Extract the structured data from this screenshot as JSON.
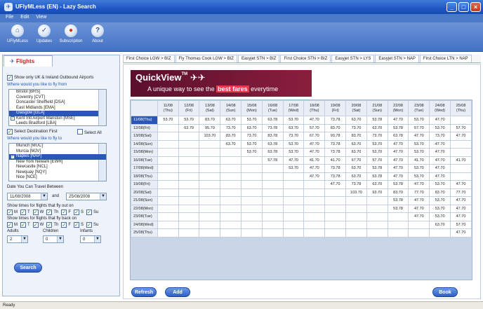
{
  "window": {
    "title": "UFlyMLess (EN) - Lazy Search",
    "min": "_",
    "max": "□",
    "close": "×"
  },
  "menu": [
    "File",
    "Edit",
    "View"
  ],
  "toolbar": [
    {
      "label": "UFlyMLess",
      "icon": "home-icon"
    },
    {
      "label": "Updates",
      "icon": "check-icon"
    },
    {
      "label": "Subscription",
      "icon": "subscription-icon"
    },
    {
      "label": "About",
      "icon": "info-icon"
    }
  ],
  "left": {
    "tab": "Flights",
    "uk_only": "Show only UK & Ireland Outbound Airports",
    "from_label": "Where would you like to fly from",
    "from_airports": [
      "Bristol [BRS]",
      "Coventry [CVT]",
      "Doncaster Sheffield [DSA]",
      "East Midlands [EMA]",
      "Glasgow [GLA]",
      "Kent Intl Airport Manston [MSE]",
      "Leeds Bradford [LBA]"
    ],
    "from_selected": 4,
    "from_checked": [
      5
    ],
    "select_dest": "Select Destination First",
    "select_all": "Select All",
    "to_label": "Where would you like to fly to",
    "to_airports": [
      "Munich [MUC]",
      "Murcia [MJV]",
      "Naples [NAP]",
      "New York Newark [EWR]",
      "Newcastle [NCL]",
      "Newquay [NQY]",
      "Nice [NCE]"
    ],
    "to_selected": 2,
    "to_checked": [
      2
    ],
    "date_label": "Date You Can Travel Between",
    "date_from": "11/08/2008",
    "date_and": "and",
    "date_to": "25/08/2008",
    "out_label": "Show times for flights that fly out on",
    "back_label": "Show times for flights that fly back on",
    "days": [
      "M",
      "T",
      "W",
      "Th",
      "F",
      "S",
      "Su"
    ],
    "adults_label": "Adults",
    "children_label": "Children",
    "infants_label": "Infants",
    "adults": "2",
    "children": "0",
    "infants": "0",
    "search": "Search"
  },
  "tabs": [
    "First Choice LGW > BIZ",
    "Fly Thomas Cook LGW > BIZ",
    "Easyjet STN > BIZ",
    "First Choice STN > BIZ",
    "Easyjet STN > LYS",
    "Easyjet STN > NAP",
    "First Choice LTN > NAP"
  ],
  "banner": {
    "title": "QuickView",
    "tm": "TM",
    "pre": "A unique way to see the",
    "highlight": "best fares",
    "post": "everytime"
  },
  "grid": {
    "columns": [
      [
        "11/08",
        "(Thu)"
      ],
      [
        "12/08",
        "(Fri)"
      ],
      [
        "13/08",
        "(Sat)"
      ],
      [
        "14/08",
        "(Sun)"
      ],
      [
        "15/08",
        "(Mon)"
      ],
      [
        "16/08",
        "(Tue)"
      ],
      [
        "17/08",
        "(Wed)"
      ],
      [
        "18/08",
        "(Thu)"
      ],
      [
        "19/08",
        "(Fri)"
      ],
      [
        "20/08",
        "(Sat)"
      ],
      [
        "21/08",
        "(Sun)"
      ],
      [
        "22/08",
        "(Mon)"
      ],
      [
        "23/08",
        "(Tue)"
      ],
      [
        "24/08",
        "(Wed)"
      ],
      [
        "25/08",
        "(Thu)"
      ]
    ],
    "rows": [
      {
        "label": "11/08(Thu)",
        "start": 0,
        "values": [
          "53.70",
          "53.70",
          "83.70",
          "63.70",
          "53.70",
          "63.78",
          "53.70",
          "47.70",
          "73.78",
          "63.70",
          "53.78",
          "47.70",
          "53.70",
          "47.70"
        ]
      },
      {
        "label": "12/08(Fri)",
        "start": 1,
        "values": [
          "63.79",
          "95.70",
          "73.70",
          "63.70",
          "73.78",
          "63.70",
          "57.70",
          "83.70",
          "73.70",
          "63.70",
          "53.78",
          "57.70",
          "53.70",
          "57.70"
        ]
      },
      {
        "label": "13/08(Sat)",
        "start": 2,
        "values": [
          "103.70",
          "83.70",
          "73.70",
          "83.78",
          "73.70",
          "67.70",
          "93.78",
          "83.70",
          "73.70",
          "63.78",
          "47.70",
          "73.70",
          "47.70"
        ]
      },
      {
        "label": "14/08(Sun)",
        "start": 3,
        "values": [
          "63.70",
          "53.70",
          "63.78",
          "53.70",
          "47.70",
          "73.78",
          "63.70",
          "53.70",
          "47.70",
          "53.70",
          "47.70"
        ]
      },
      {
        "label": "15/08(Mon)",
        "start": 4,
        "values": [
          "53.70",
          "63.78",
          "53.70",
          "47.70",
          "73.78",
          "63.70",
          "53.70",
          "47.70",
          "53.70",
          "47.70"
        ]
      },
      {
        "label": "16/08(Tue)",
        "start": 5,
        "values": [
          "57.78",
          "47.70",
          "41.70",
          "41.70",
          "67.70",
          "57.70",
          "47.70",
          "41.70",
          "47.70",
          "41.70"
        ]
      },
      {
        "label": "17/08(Wed)",
        "start": 6,
        "values": [
          "53.70",
          "47.70",
          "73.78",
          "63.70",
          "53.78",
          "47.70",
          "53.70",
          "47.70"
        ]
      },
      {
        "label": "18/08(Thu)",
        "start": 7,
        "values": [
          "47.70",
          "73.78",
          "63.70",
          "53.78",
          "47.70",
          "53.70",
          "47.70"
        ]
      },
      {
        "label": "19/08(Fri)",
        "start": 8,
        "values": [
          "47.70",
          "73.78",
          "63.70",
          "53.78",
          "47.70",
          "53.70",
          "47.70"
        ]
      },
      {
        "label": "20/08(Sat)",
        "start": 9,
        "values": [
          "103.70",
          "93.70",
          "83.70",
          "77.70",
          "83.70",
          "77.70"
        ]
      },
      {
        "label": "21/08(Sun)",
        "start": 11,
        "values": [
          "53.78",
          "47.70",
          "53.70",
          "47.70"
        ]
      },
      {
        "label": "22/08(Mon)",
        "start": 11,
        "values": [
          "53.78",
          "47.70",
          "53.70",
          "47.70"
        ]
      },
      {
        "label": "23/08(Tue)",
        "start": 12,
        "values": [
          "47.70",
          "53.70",
          "47.70"
        ]
      },
      {
        "label": "24/08(Wed)",
        "start": 13,
        "values": [
          "63.70",
          "57.70"
        ]
      },
      {
        "label": "25/08(Thu)",
        "start": 14,
        "values": [
          "47.70"
        ]
      }
    ],
    "selected_row": 0
  },
  "buttons": {
    "refresh": "Refresh",
    "add": "Add",
    "book": "Book"
  },
  "status": "Ready"
}
